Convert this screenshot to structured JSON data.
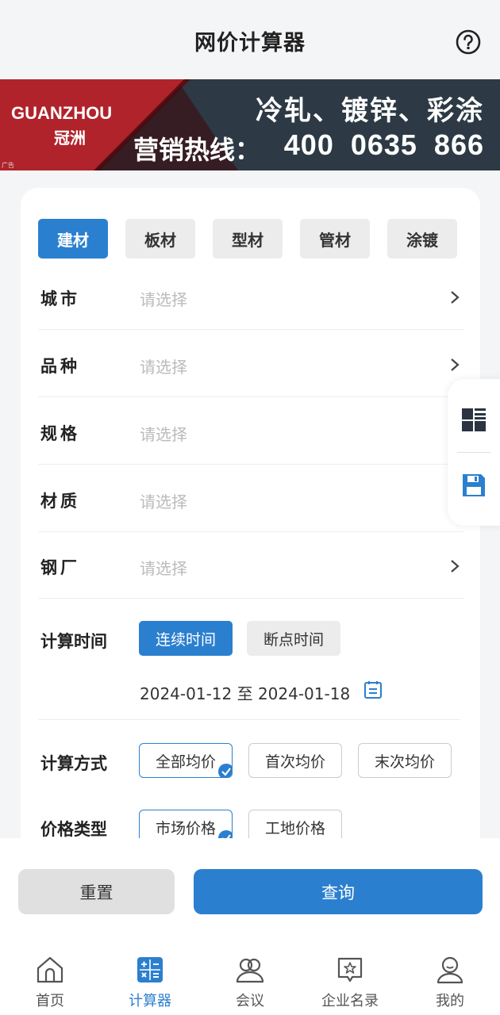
{
  "header": {
    "title": "网价计算器",
    "help_icon": "help-circle-icon"
  },
  "banner": {
    "brand_en": "GUANZHOU",
    "brand_cn": "冠洲",
    "line1": "冷轧、镀锌、彩涂",
    "hotline_label": "营销热线：",
    "hotline_number": "400  0635  866",
    "ad_tag": "广告"
  },
  "tabs": [
    {
      "label": "建材",
      "active": true
    },
    {
      "label": "板材",
      "active": false
    },
    {
      "label": "型材",
      "active": false
    },
    {
      "label": "管材",
      "active": false
    },
    {
      "label": "涂镀",
      "active": false
    }
  ],
  "fields": [
    {
      "label": "城市",
      "placeholder": "请选择",
      "chevron": true
    },
    {
      "label": "品种",
      "placeholder": "请选择",
      "chevron": true
    },
    {
      "label": "规格",
      "placeholder": "请选择",
      "chevron": false
    },
    {
      "label": "材质",
      "placeholder": "请选择",
      "chevron": false
    },
    {
      "label": "钢厂",
      "placeholder": "请选择",
      "chevron": true
    }
  ],
  "calc_time": {
    "label": "计算时间",
    "options": [
      "连续时间",
      "断点时间"
    ],
    "selected": "连续时间",
    "date_range": "2024-01-12 至 2024-01-18"
  },
  "calc_method": {
    "label": "计算方式",
    "options": [
      "全部均价",
      "首次均价",
      "末次均价"
    ],
    "selected": "全部均价"
  },
  "price_type": {
    "label": "价格类型",
    "options": [
      "市场价格",
      "工地价格"
    ],
    "selected": "市场价格"
  },
  "actions": {
    "reset": "重置",
    "query": "查询"
  },
  "nav": [
    {
      "label": "首页",
      "icon": "home-icon",
      "active": false
    },
    {
      "label": "计算器",
      "icon": "calculator-icon",
      "active": true
    },
    {
      "label": "会议",
      "icon": "meeting-icon",
      "active": false
    },
    {
      "label": "企业名录",
      "icon": "directory-icon",
      "active": false
    },
    {
      "label": "我的",
      "icon": "profile-icon",
      "active": false
    }
  ],
  "colors": {
    "accent": "#2b7fcf",
    "banner_red": "#b0232b",
    "banner_dark": "#2d3a45"
  }
}
